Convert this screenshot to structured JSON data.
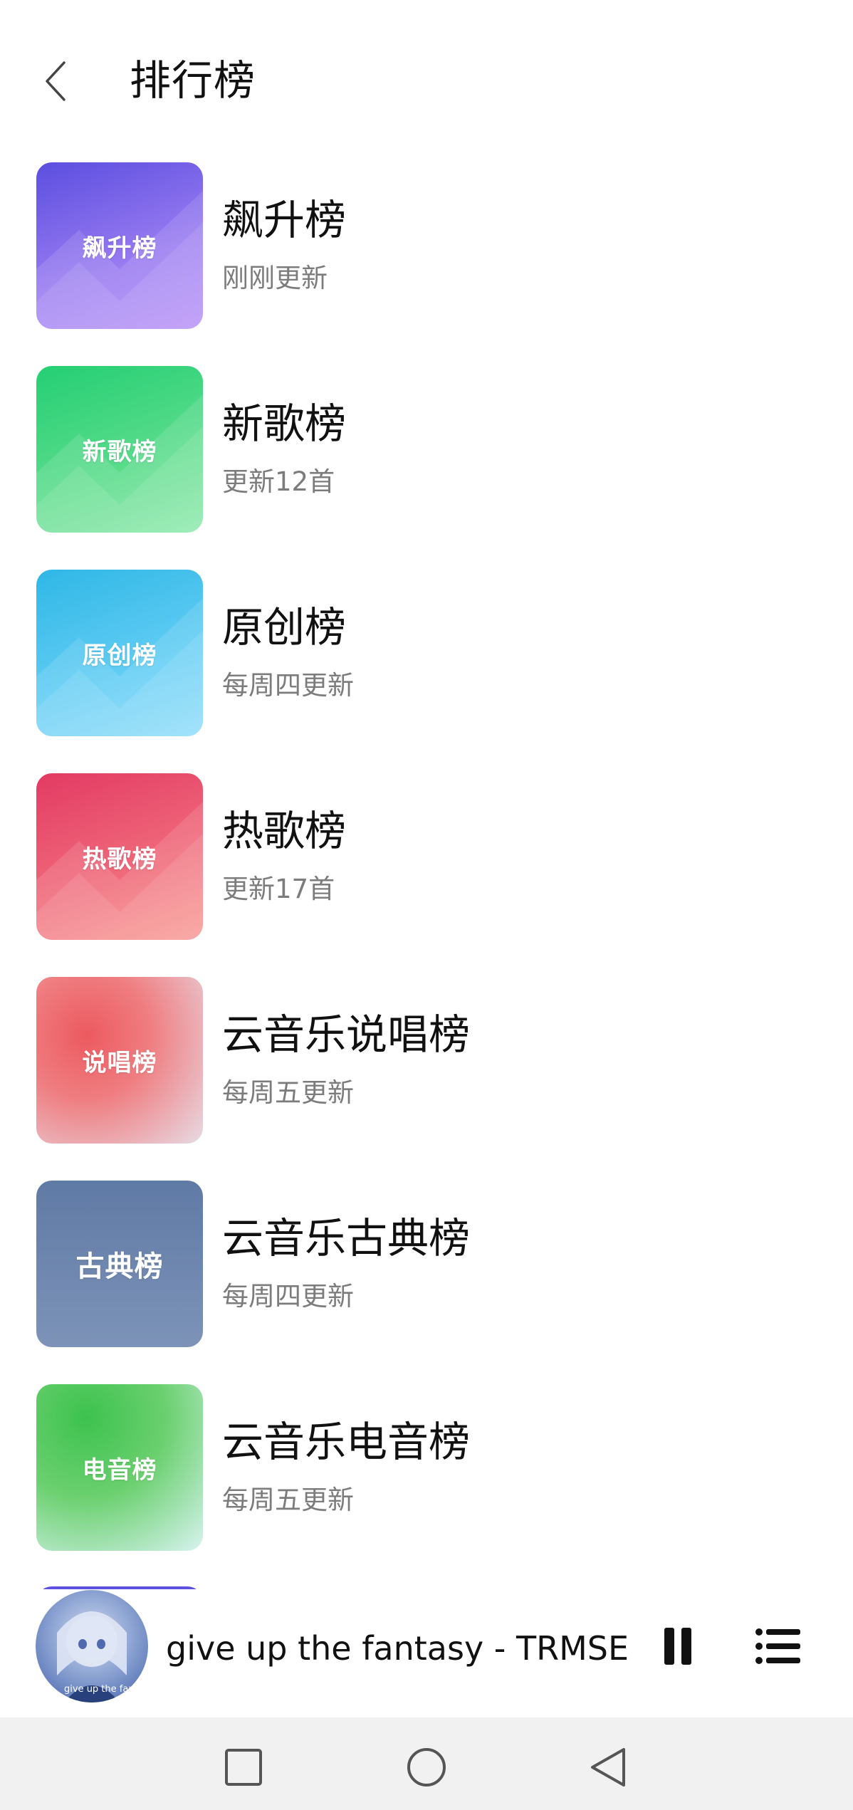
{
  "header": {
    "back_icon": "chevron-left-icon",
    "title": "排行榜"
  },
  "charts": [
    {
      "cover_text": "飙升榜",
      "title": "飙升榜",
      "subtitle": "刚刚更新",
      "colors": [
        "#5b4ee0",
        "#b58cf7"
      ]
    },
    {
      "cover_text": "新歌榜",
      "title": "新歌榜",
      "subtitle": "更新12首",
      "colors": [
        "#24cf74",
        "#86e8a6"
      ]
    },
    {
      "cover_text": "原创榜",
      "title": "原创榜",
      "subtitle": "每周四更新",
      "colors": [
        "#2fb7e6",
        "#8adcfb"
      ]
    },
    {
      "cover_text": "热歌榜",
      "title": "热歌榜",
      "subtitle": "更新17首",
      "colors": [
        "#e33a63",
        "#f9958e"
      ]
    },
    {
      "cover_text": "说唱榜",
      "title": "云音乐说唱榜",
      "subtitle": "每周五更新",
      "colors": [
        "#ec5a5f",
        "#e7dbe4"
      ]
    },
    {
      "cover_text": "古典榜",
      "title": "云音乐古典榜",
      "subtitle": "每周四更新",
      "colors": [
        "#5f7aa5",
        "#7d93b8"
      ]
    },
    {
      "cover_text": "电音榜",
      "title": "云音乐电音榜",
      "subtitle": "每周五更新",
      "colors": [
        "#3dc24e",
        "#d8f3f0"
      ]
    }
  ],
  "player": {
    "track": "give up the fantasy - TRMSE",
    "album_caption": "give up the fantasy",
    "pause_icon": "pause-icon",
    "playlist_icon": "playlist-icon"
  },
  "navigation": {
    "recents_icon": "square-icon",
    "home_icon": "circle-icon",
    "back_icon": "triangle-back-icon"
  }
}
